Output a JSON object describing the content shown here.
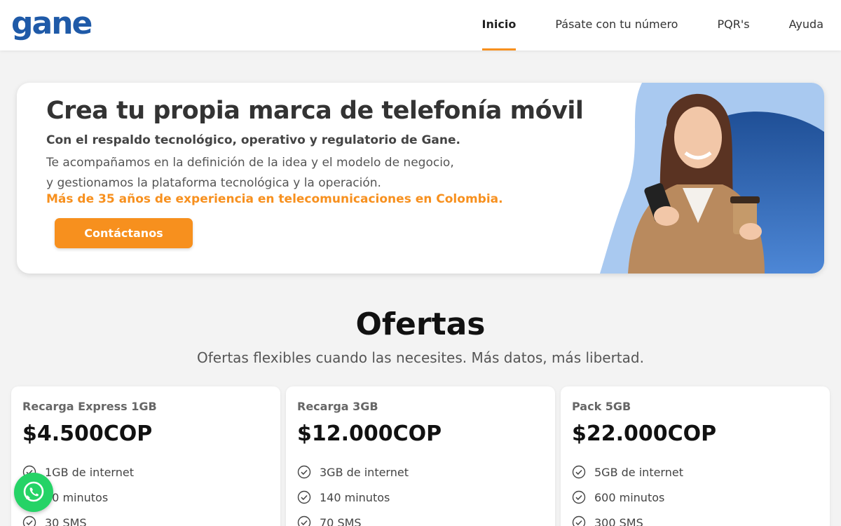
{
  "header": {
    "logo": "gane",
    "nav": [
      {
        "label": "Inicio",
        "active": true
      },
      {
        "label": "Pásate con tu número",
        "active": false
      },
      {
        "label": "PQR's",
        "active": false
      },
      {
        "label": "Ayuda",
        "active": false
      }
    ]
  },
  "hero": {
    "title": "Crea tu propia marca de telefonía móvil",
    "subtitle": "Con el respaldo tecnológico, operativo y regulatorio de Gane.",
    "description_line1": "Te acompañamos en la definición de la idea y el modelo de negocio,",
    "description_line2": "y gestionamos la plataforma tecnológica y la operación.",
    "highlight": "Más de 35 años de experiencia en telecomunicaciones en Colombia.",
    "cta_label": "Contáctanos"
  },
  "offers": {
    "title": "Ofertas",
    "subtitle": "Ofertas flexibles cuando las necesites. Más datos, más libertad.",
    "cards": [
      {
        "name": "Recarga Express 1GB",
        "price": "$4.500COP",
        "features": [
          "1GB de internet",
          "60 minutos",
          "30 SMS"
        ]
      },
      {
        "name": "Recarga 3GB",
        "price": "$12.000COP",
        "features": [
          "3GB de internet",
          "140 minutos",
          "70 SMS"
        ]
      },
      {
        "name": "Pack 5GB",
        "price": "$22.000COP",
        "features": [
          "5GB de internet",
          "600 minutos",
          "300 SMS"
        ]
      }
    ]
  },
  "colors": {
    "brand_blue": "#1f5aa8",
    "accent_orange": "#f7901e",
    "whatsapp_green": "#25d366"
  },
  "icons": {
    "feature": "check-circle-icon",
    "floating": "whatsapp-icon"
  }
}
